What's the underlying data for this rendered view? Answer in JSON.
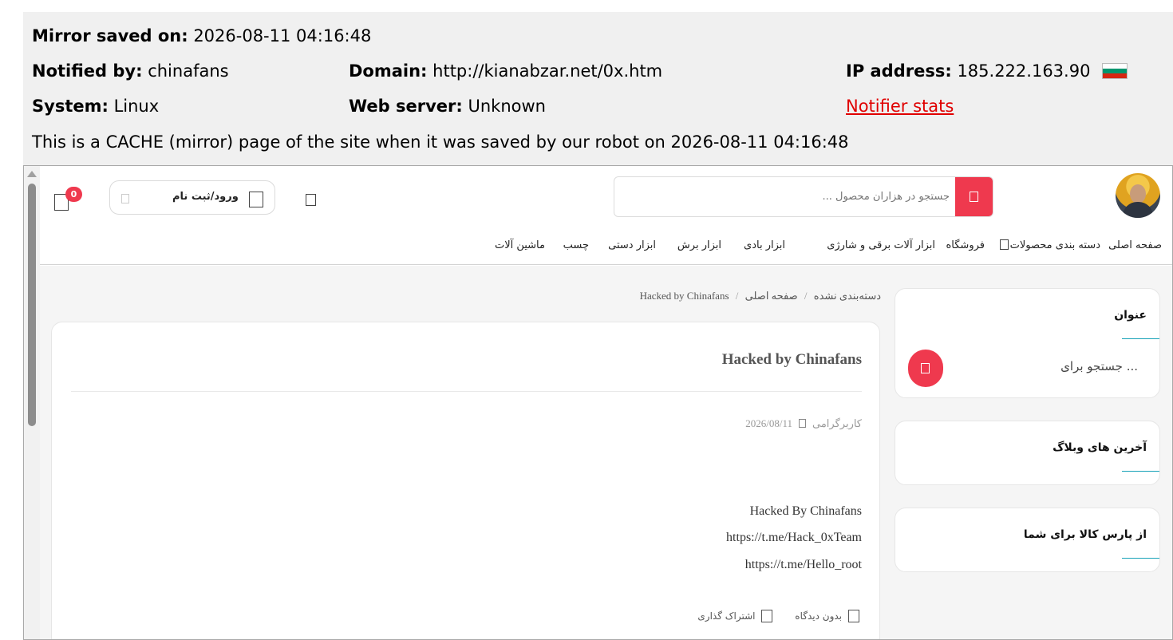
{
  "mirror": {
    "saved_label": "Mirror saved on:",
    "saved_value": "2026-08-11 04:16:48",
    "notified_label": "Notified by:",
    "notified_value": "chinafans",
    "domain_label": "Domain:",
    "domain_value": "http://kianabzar.net/0x.htm",
    "ip_label": "IP address:",
    "ip_value": "185.222.163.90",
    "system_label": "System:",
    "system_value": "Linux",
    "webserver_label": "Web server:",
    "webserver_value": "Unknown",
    "notifier_stats": "Notifier stats",
    "cache_notice": "This is a CACHE (mirror) page of the site when it was saved by our robot on 2026-08-11 04:16:48"
  },
  "site": {
    "cart_count": "0",
    "login_label": "ورود/ثبت نام",
    "search_placeholder": "جستجو در هزاران محصول ...",
    "nav": [
      "صفحه اصلی",
      "دسته بندی محصولات",
      "فروشگاه",
      "ابزار آلات برقی و شارژی",
      "ابزار بادی",
      "ابزار برش",
      "ابزار دستی",
      "چسب",
      "ماشین آلات"
    ],
    "breadcrumb": {
      "home": "صفحه اصلی",
      "category": "دسته‌بندی نشده",
      "current": "Hacked by Chinafans"
    },
    "post": {
      "title": "Hacked by Chinafans",
      "date": "2026/08/11",
      "author": "کاربرگرامی",
      "lines": [
        "Hacked By Chinafans",
        "https://t.me/Hack_0xTeam",
        "https://t.me/Hello_root"
      ],
      "no_comment": "بدون دیدگاه",
      "share": "اشتراک گذاری"
    },
    "widgets": {
      "search_title": "عنوان",
      "search_placeholder": "جستجو برای ...",
      "latest_title": "آخرین های وبلاگ",
      "pars_title": "از پارس کالا برای شما"
    }
  },
  "colors": {
    "accent": "#ef394e",
    "link_red": "#e00000",
    "underline_teal": "#17a2b8"
  }
}
